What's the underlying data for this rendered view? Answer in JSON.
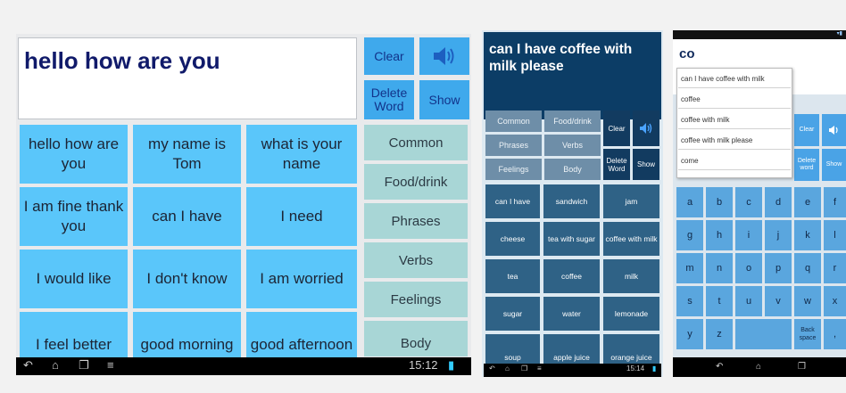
{
  "panel1": {
    "display_text": "hello how are you",
    "buttons": {
      "clear": "Clear",
      "delete_word": "Delete Word",
      "show": "Show",
      "speaker_icon": "speaker-icon"
    },
    "phrases": [
      [
        "hello how are you",
        "my name is Tom",
        "what is your name"
      ],
      [
        "I am fine thank you",
        "can I have",
        "I need"
      ],
      [
        "I would like",
        "I don't know",
        "I am worried"
      ],
      [
        "I feel better",
        "good morning",
        "good afternoon"
      ]
    ],
    "categories": [
      "Common",
      "Food/drink",
      "Phrases",
      "Verbs",
      "Feelings",
      "Body"
    ],
    "status": {
      "time": "15:12"
    }
  },
  "panel2": {
    "display_text": "can I have coffee with milk please",
    "categories": [
      "Common",
      "Food/drink",
      "Phrases",
      "Verbs",
      "Feelings",
      "Body"
    ],
    "buttons": {
      "clear": "Clear",
      "delete_word": "Delete Word",
      "show": "Show"
    },
    "words": [
      [
        "can I have",
        "sandwich",
        "jam"
      ],
      [
        "cheese",
        "tea with sugar",
        "coffee with milk"
      ],
      [
        "tea",
        "coffee",
        "milk"
      ],
      [
        "sugar",
        "water",
        "lemonade"
      ],
      [
        "soup",
        "apple juice",
        "orange juice"
      ]
    ],
    "status": {
      "time": "15:14"
    }
  },
  "panel3": {
    "input_text": "co",
    "autocomplete": [
      "can I have coffee with milk",
      "coffee",
      "coffee with milk",
      "coffee with milk please",
      "come"
    ],
    "buttons": {
      "clear": "Clear",
      "delete_word": "Delete word",
      "show": "Show"
    },
    "keys": [
      [
        "a",
        "b",
        "c",
        "d",
        "e",
        "f"
      ],
      [
        "g",
        "h",
        "i",
        "j",
        "k",
        "l"
      ],
      [
        "m",
        "n",
        "o",
        "p",
        "q",
        "r"
      ],
      [
        "s",
        "t",
        "u",
        "v",
        "w",
        "x"
      ],
      [
        "y",
        "z",
        "",
        "",
        "Back space",
        ","
      ]
    ]
  }
}
